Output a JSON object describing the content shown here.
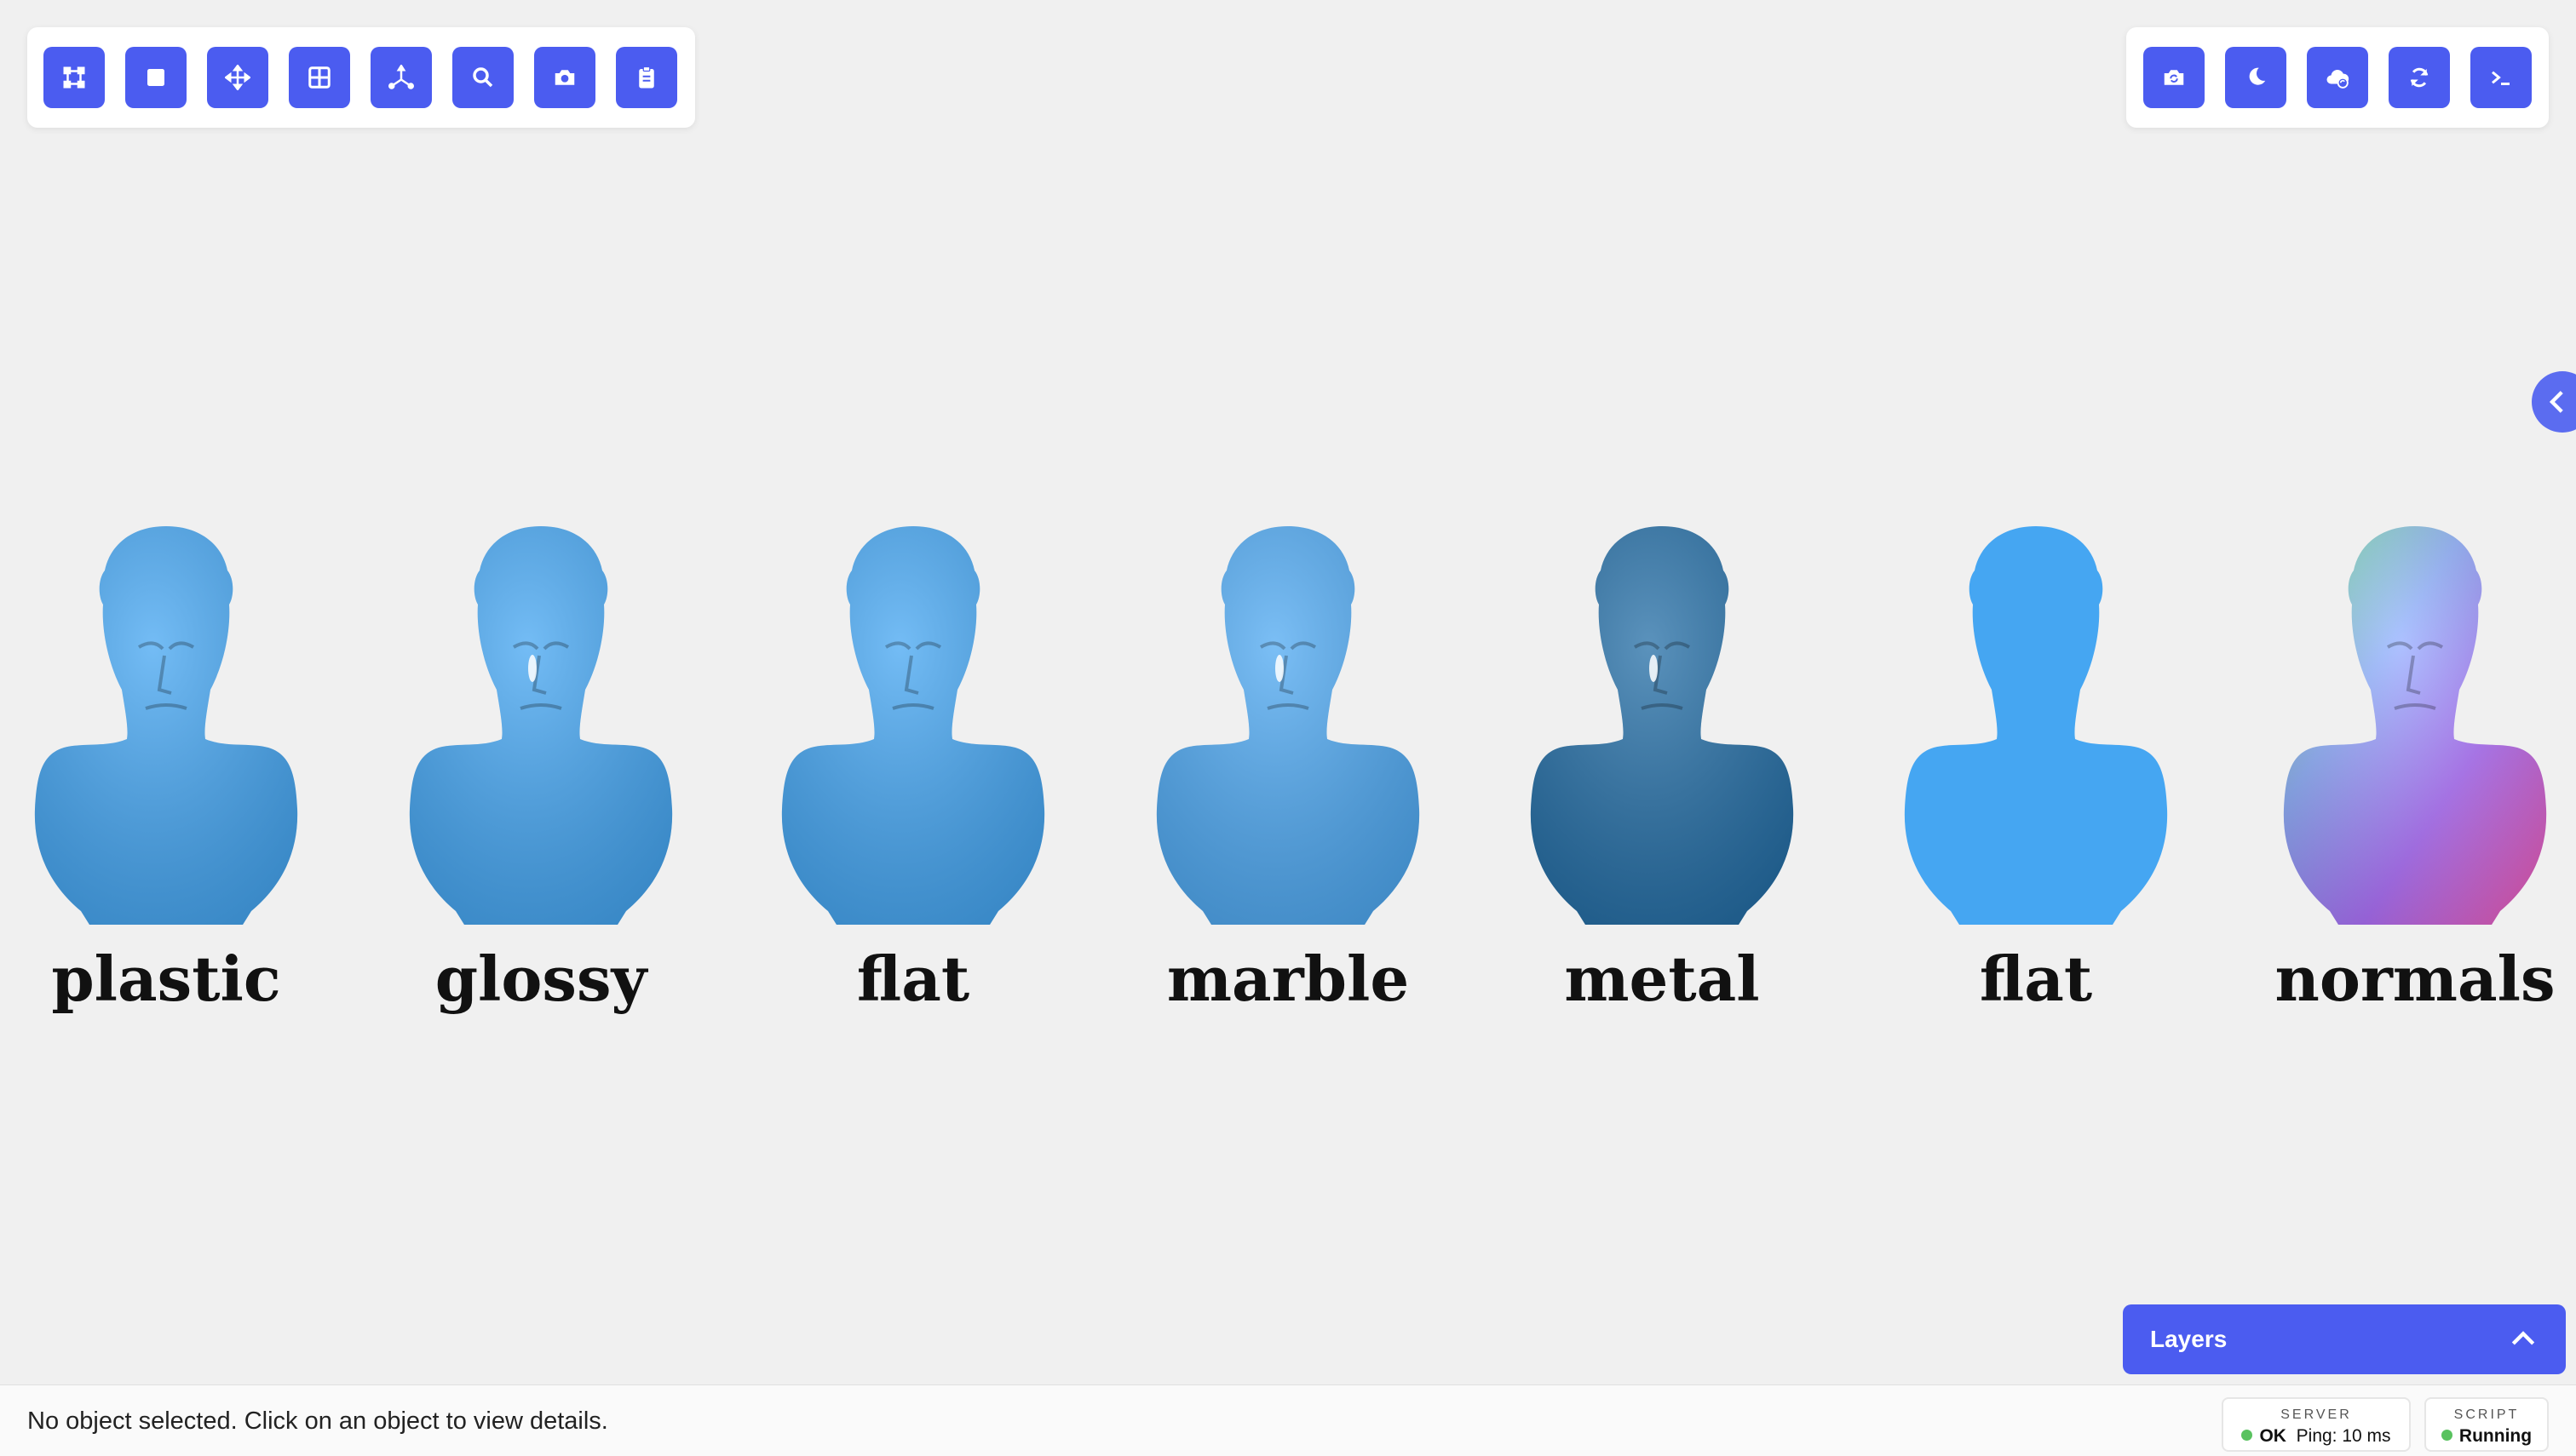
{
  "toolbar_left": {
    "buttons": [
      {
        "icon": "bounding-box-icon"
      },
      {
        "icon": "square-icon"
      },
      {
        "icon": "move-arrows-icon"
      },
      {
        "icon": "grid-icon"
      },
      {
        "icon": "axes-icon"
      },
      {
        "icon": "search-icon"
      },
      {
        "icon": "camera-icon"
      },
      {
        "icon": "clipboard-icon"
      }
    ]
  },
  "toolbar_right": {
    "buttons": [
      {
        "icon": "camera-swap-icon"
      },
      {
        "icon": "moon-icon"
      },
      {
        "icon": "cloud-sync-icon"
      },
      {
        "icon": "refresh-icon"
      },
      {
        "icon": "terminal-icon"
      }
    ]
  },
  "viewport": {
    "busts": [
      {
        "label": "plastic",
        "material": "plastic",
        "color": "#45a6f2"
      },
      {
        "label": "glossy",
        "material": "glossy",
        "color": "#45a6f2"
      },
      {
        "label": "flat",
        "material": "flat",
        "color": "#45a6f2"
      },
      {
        "label": "marble",
        "material": "marble",
        "color": "#4fa9f2"
      },
      {
        "label": "metal",
        "material": "metal",
        "color": "#246ea6"
      },
      {
        "label": "flat",
        "material": "flat-unlit",
        "color": "#45a6f2"
      },
      {
        "label": "normals",
        "material": "normals",
        "color": "#8a8af0"
      }
    ]
  },
  "layers": {
    "title": "Layers"
  },
  "status": {
    "message": "No object selected. Click on an object to view details.",
    "server": {
      "caption": "SERVER",
      "state": "OK",
      "ping": "Ping: 10 ms"
    },
    "script": {
      "caption": "SCRIPT",
      "state": "Running"
    },
    "ok_color": "#59c25f"
  },
  "colors": {
    "accent": "#4b5cf0",
    "background": "#f0f0f0"
  }
}
